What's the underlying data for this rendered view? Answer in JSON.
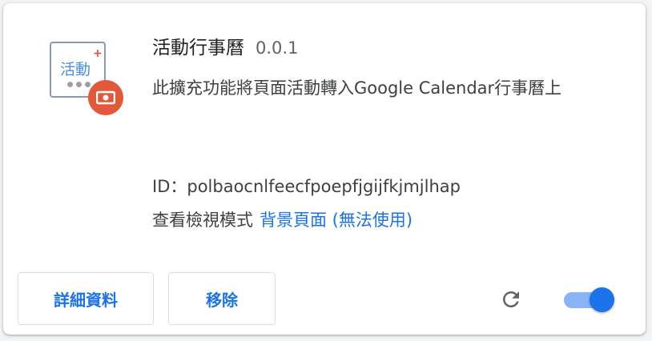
{
  "extension": {
    "name": "活動行事曆",
    "version": "0.0.1",
    "description": "此擴充功能將頁面活動轉入Google Calendar行事曆上",
    "icon_text": "活動",
    "icon_plus": "+",
    "id_label": "ID：",
    "id_value": "polbaocnlfeecfpoepfjgijfkjmjlhap",
    "inspect_label": "查看檢視模式",
    "inspect_link": "背景頁面 (無法使用)",
    "enabled": true
  },
  "buttons": {
    "details_label": "詳細資料",
    "remove_label": "移除"
  },
  "icons": {
    "reload": "reload-icon",
    "badge": "camera-badge-icon"
  },
  "colors": {
    "accent": "#1a73e8",
    "toggle_track": "#8ab4f8",
    "badge": "#e2583b",
    "icon_text": "#4a90d9"
  }
}
